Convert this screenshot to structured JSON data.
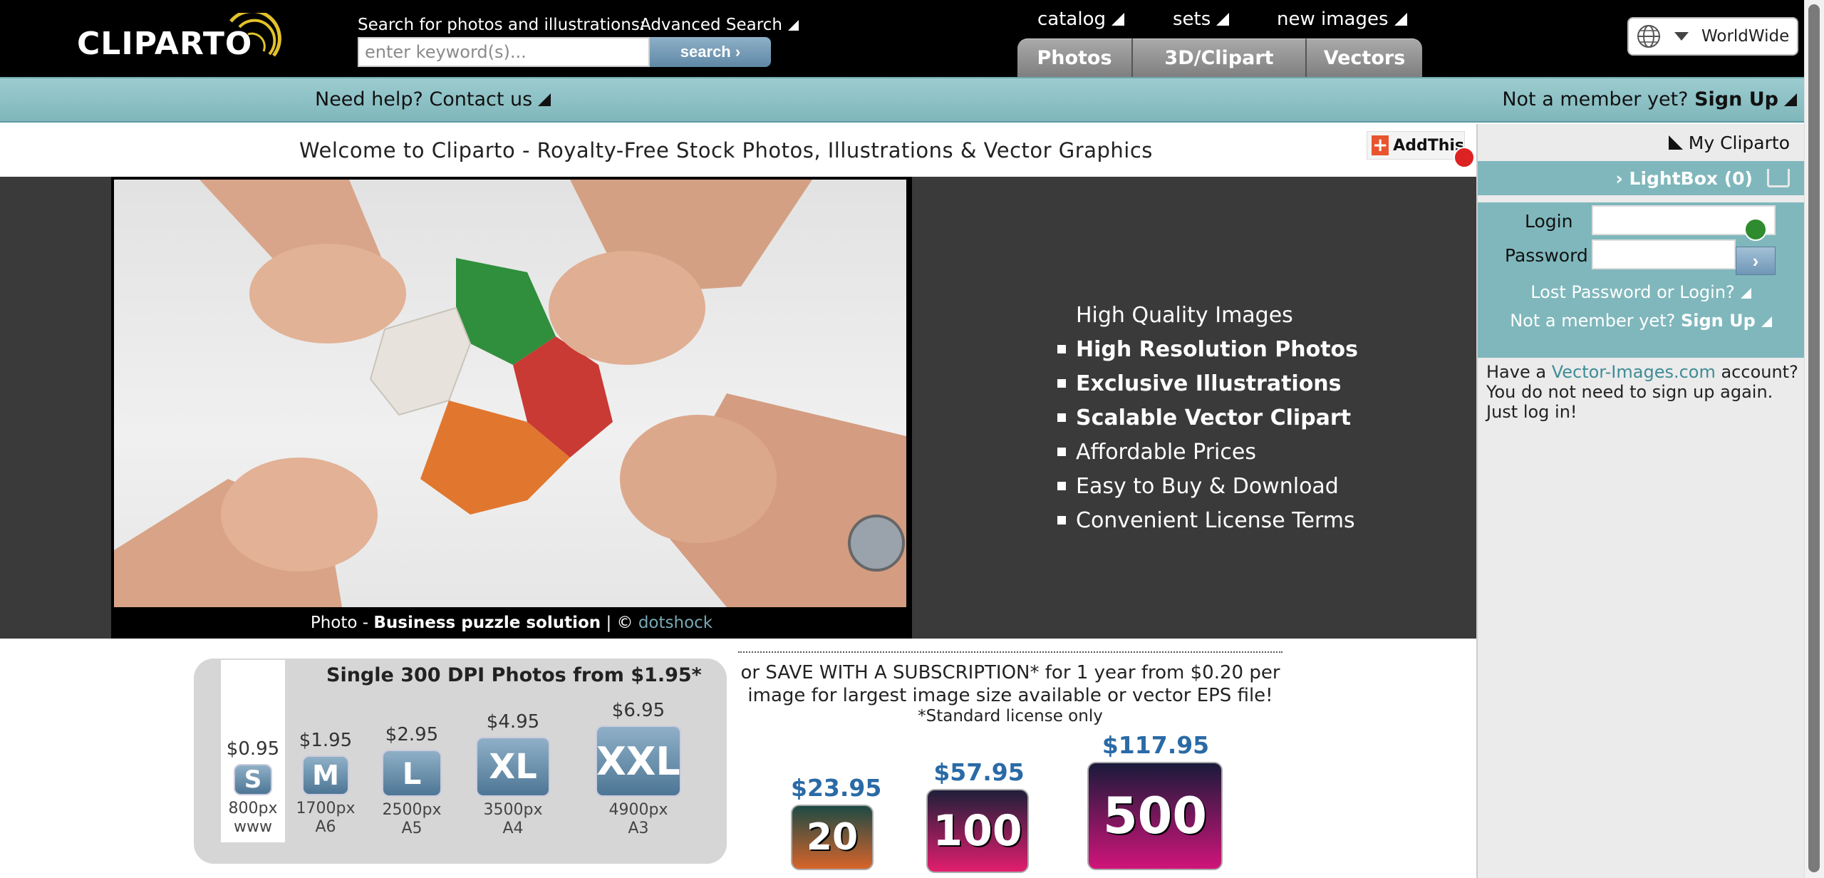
{
  "header": {
    "logo_text": "CLIPARTO",
    "search_label": "Search for photos and illustrations:",
    "advanced_search": "Advanced Search",
    "search_placeholder": "enter keyword(s)...",
    "search_button": "search ›",
    "nav": [
      {
        "label": "catalog"
      },
      {
        "label": "sets"
      },
      {
        "label": "new images"
      }
    ],
    "tabs": [
      {
        "label": "Photos"
      },
      {
        "label": "3D/Clipart"
      },
      {
        "label": "Vectors"
      }
    ],
    "region": "WorldWide"
  },
  "subheader": {
    "help": "Need help? Contact us",
    "member_prefix": "Not a member yet?",
    "signup": "Sign Up"
  },
  "welcome": {
    "title": "Welcome to Cliparto - Royalty-Free Stock Photos, Illustrations & Vector Graphics",
    "addthis": "AddThis"
  },
  "hero": {
    "caption_prefix": "Photo - ",
    "caption_title": "Business puzzle solution",
    "caption_sep": " | © ",
    "caption_author": "dotshock",
    "features_intro": "High Quality Images",
    "features": [
      {
        "label": "High Resolution Photos",
        "bold": true
      },
      {
        "label": "Exclusive Illustrations",
        "bold": true
      },
      {
        "label": "Scalable Vector Clipart",
        "bold": true
      },
      {
        "label": "Affordable Prices",
        "bold": false
      },
      {
        "label": "Easy to Buy & Download",
        "bold": false
      },
      {
        "label": "Convenient License Terms",
        "bold": false
      }
    ]
  },
  "sidebar": {
    "my_cliparto": "My Cliparto",
    "lightbox": "› LightBox (0)",
    "login_label": "Login",
    "password_label": "Password",
    "login_button": "›",
    "lost_password": "Lost Password or Login?",
    "member_prefix": "Not a member yet?",
    "signup": "Sign Up",
    "have_prefix": "Have a ",
    "have_link": "Vector-Images.com",
    "have_suffix": " account? You do not need to sign up again. Just log in!"
  },
  "pricing": {
    "heading": "Single 300 DPI Photos from $1.95*",
    "sizes": [
      {
        "price": "$0.95",
        "code": "S",
        "px": "800px",
        "paper": "www"
      },
      {
        "price": "$1.95",
        "code": "M",
        "px": "1700px",
        "paper": "A6"
      },
      {
        "price": "$2.95",
        "code": "L",
        "px": "2500px",
        "paper": "A5"
      },
      {
        "price": "$4.95",
        "code": "XL",
        "px": "3500px",
        "paper": "A4"
      },
      {
        "price": "$6.95",
        "code": "XXL",
        "px": "4900px",
        "paper": "A3"
      }
    ]
  },
  "subscription": {
    "text": "or SAVE WITH A SUBSCRIPTION* for 1 year from $0.20 per image for largest image size available or vector EPS file!",
    "note": "*Standard license only",
    "plans": [
      {
        "price": "$23.95",
        "count": "20"
      },
      {
        "price": "$57.95",
        "count": "100"
      },
      {
        "price": "$117.95",
        "count": "500"
      }
    ]
  }
}
